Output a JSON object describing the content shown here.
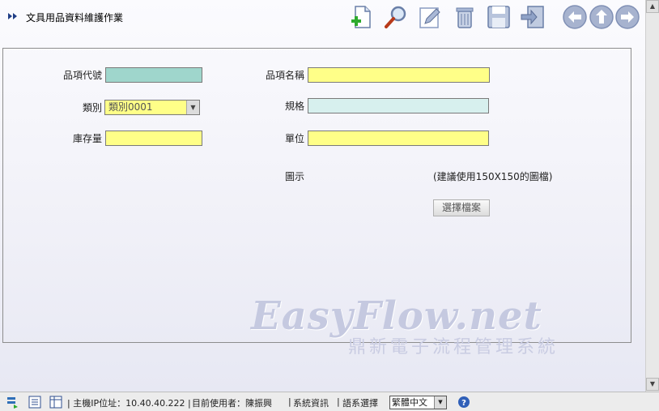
{
  "header": {
    "title": "文具用品資料維護作業",
    "toolbar": [
      "add-icon",
      "search-icon",
      "edit-icon",
      "delete-icon",
      "save-icon",
      "exit-icon",
      "back-icon",
      "up-icon",
      "forward-icon"
    ]
  },
  "form": {
    "item_code_label": "品項代號",
    "item_code_value": "",
    "item_name_label": "品項名稱",
    "item_name_value": "",
    "category_label": "類別",
    "category_value": "類別0001",
    "spec_label": "規格",
    "spec_value": "",
    "stock_label": "庫存量",
    "stock_value": "",
    "unit_label": "單位",
    "unit_value": "",
    "image_label": "圖示",
    "image_hint": "(建議使用150X150的圖檔)",
    "choose_file": "選擇檔案"
  },
  "watermark": {
    "brand": "EasyFlow.net",
    "subtitle": "鼎新電子流程管理系統"
  },
  "status": {
    "host_ip": "主機IP位址：10.40.40.222",
    "current_user": "目前使用者：陳振興",
    "system_info": "系統資訊",
    "language_label": "語系選擇",
    "language_value": "繁體中文"
  },
  "colors": {
    "teal_input": "#9fd6cc",
    "yellow_input": "#ffff88",
    "readonly_input": "#d7f0ee"
  }
}
